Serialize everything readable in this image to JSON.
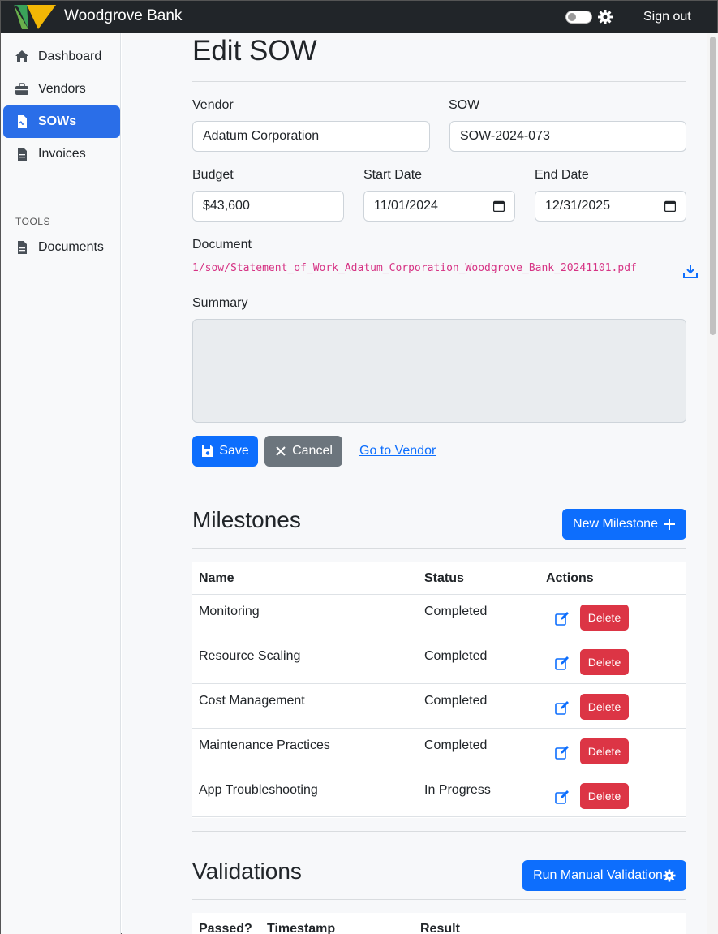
{
  "app": {
    "brand": "Woodgrove Bank",
    "sign_out": "Sign out"
  },
  "sidebar": {
    "items": [
      {
        "label": "Dashboard",
        "icon": "home-icon",
        "active": false
      },
      {
        "label": "Vendors",
        "icon": "briefcase-icon",
        "active": false
      },
      {
        "label": "SOWs",
        "icon": "document-icon",
        "active": true
      },
      {
        "label": "Invoices",
        "icon": "file-icon",
        "active": false
      }
    ],
    "tools_heading": "TOOLS",
    "tools": [
      {
        "label": "Documents",
        "icon": "file-icon"
      }
    ]
  },
  "page": {
    "title": "Edit SOW",
    "vendor_label": "Vendor",
    "vendor_value": "Adatum Corporation",
    "sow_label": "SOW",
    "sow_value": "SOW-2024-073",
    "budget_label": "Budget",
    "budget_value": "$43,600",
    "start_label": "Start Date",
    "start_value": "11/01/2024",
    "end_label": "End Date",
    "end_value": "12/31/2025",
    "document_label": "Document",
    "document_path": "1/sow/Statement_of_Work_Adatum_Corporation_Woodgrove_Bank_20241101.pdf",
    "summary_label": "Summary",
    "summary_value": "",
    "save_label": "Save",
    "cancel_label": "Cancel",
    "go_vendor_label": "Go to Vendor"
  },
  "milestones": {
    "title": "Milestones",
    "new_button": "New Milestone",
    "headers": {
      "name": "Name",
      "status": "Status",
      "actions": "Actions"
    },
    "delete_label": "Delete",
    "rows": [
      {
        "name": "Monitoring",
        "status": "Completed"
      },
      {
        "name": "Resource Scaling",
        "status": "Completed"
      },
      {
        "name": "Cost Management",
        "status": "Completed"
      },
      {
        "name": "Maintenance Practices",
        "status": "Completed"
      },
      {
        "name": "App Troubleshooting",
        "status": "In Progress"
      }
    ]
  },
  "validations": {
    "title": "Validations",
    "run_button": "Run Manual Validation",
    "headers": {
      "passed": "Passed?",
      "timestamp": "Timestamp",
      "result": "Result"
    }
  },
  "colors": {
    "primary": "#0d6efd",
    "danger": "#dc3545",
    "secondary": "#6c757d",
    "navbar": "#212529",
    "doc_link": "#d63384"
  }
}
